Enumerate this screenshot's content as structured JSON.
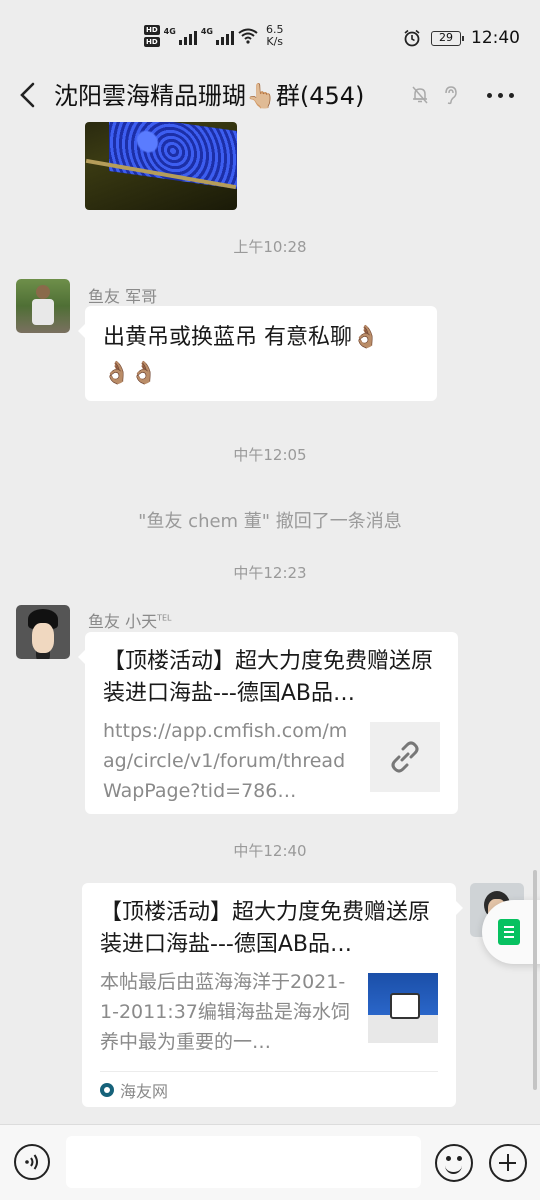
{
  "status_bar": {
    "hd_labels": [
      "HD",
      "HD"
    ],
    "signal1_type": "4G",
    "signal2_type": "4G",
    "net_speed_value": "6.5",
    "net_speed_unit": "K/s",
    "battery": "29",
    "time": "12:40"
  },
  "header": {
    "title": "沈阳雲海精品珊瑚👆🏼群(454)",
    "icons": [
      "back-arrow-icon",
      "mute-bell-icon",
      "ear-icon",
      "more-icon"
    ]
  },
  "messages": {
    "ts1": "上午10:28",
    "msg1": {
      "sender": "鱼友 军哥",
      "text": "出黄吊或换蓝吊 有意私聊",
      "emoji": "👌🏽",
      "emoji_row2": "👌🏽👌🏽"
    },
    "ts2": "中午12:05",
    "recall_notice": "\"鱼友 chem 董\" 撤回了一条消息",
    "ts3": "中午12:23",
    "msg2": {
      "sender": "鱼友 小天",
      "sender_suffix": "TEL",
      "title": "【顶楼活动】超大力度免费赠送原装进口海盐---德国AB品…",
      "desc": "https://app.cmfish.com/mag/circle/v1/forum/threadWapPage?tid=786…",
      "thumb_icon": "link-icon"
    },
    "ts4": "中午12:40",
    "msg3": {
      "title": "【顶楼活动】超大力度免费赠送原装进口海盐---德国AB品…",
      "desc": "本帖最后由蓝海海洋于2021-1-2011:37编辑海盐是海水饲养中最为重要的一…",
      "source": "海友网"
    }
  },
  "input_bar": {
    "placeholder": "",
    "icons": [
      "voice-icon",
      "emoji-icon",
      "plus-icon"
    ]
  },
  "colors": {
    "background": "#ededed",
    "bubble": "#ffffff",
    "accent_green": "#07c160",
    "meta_text": "#9a9a9a"
  }
}
